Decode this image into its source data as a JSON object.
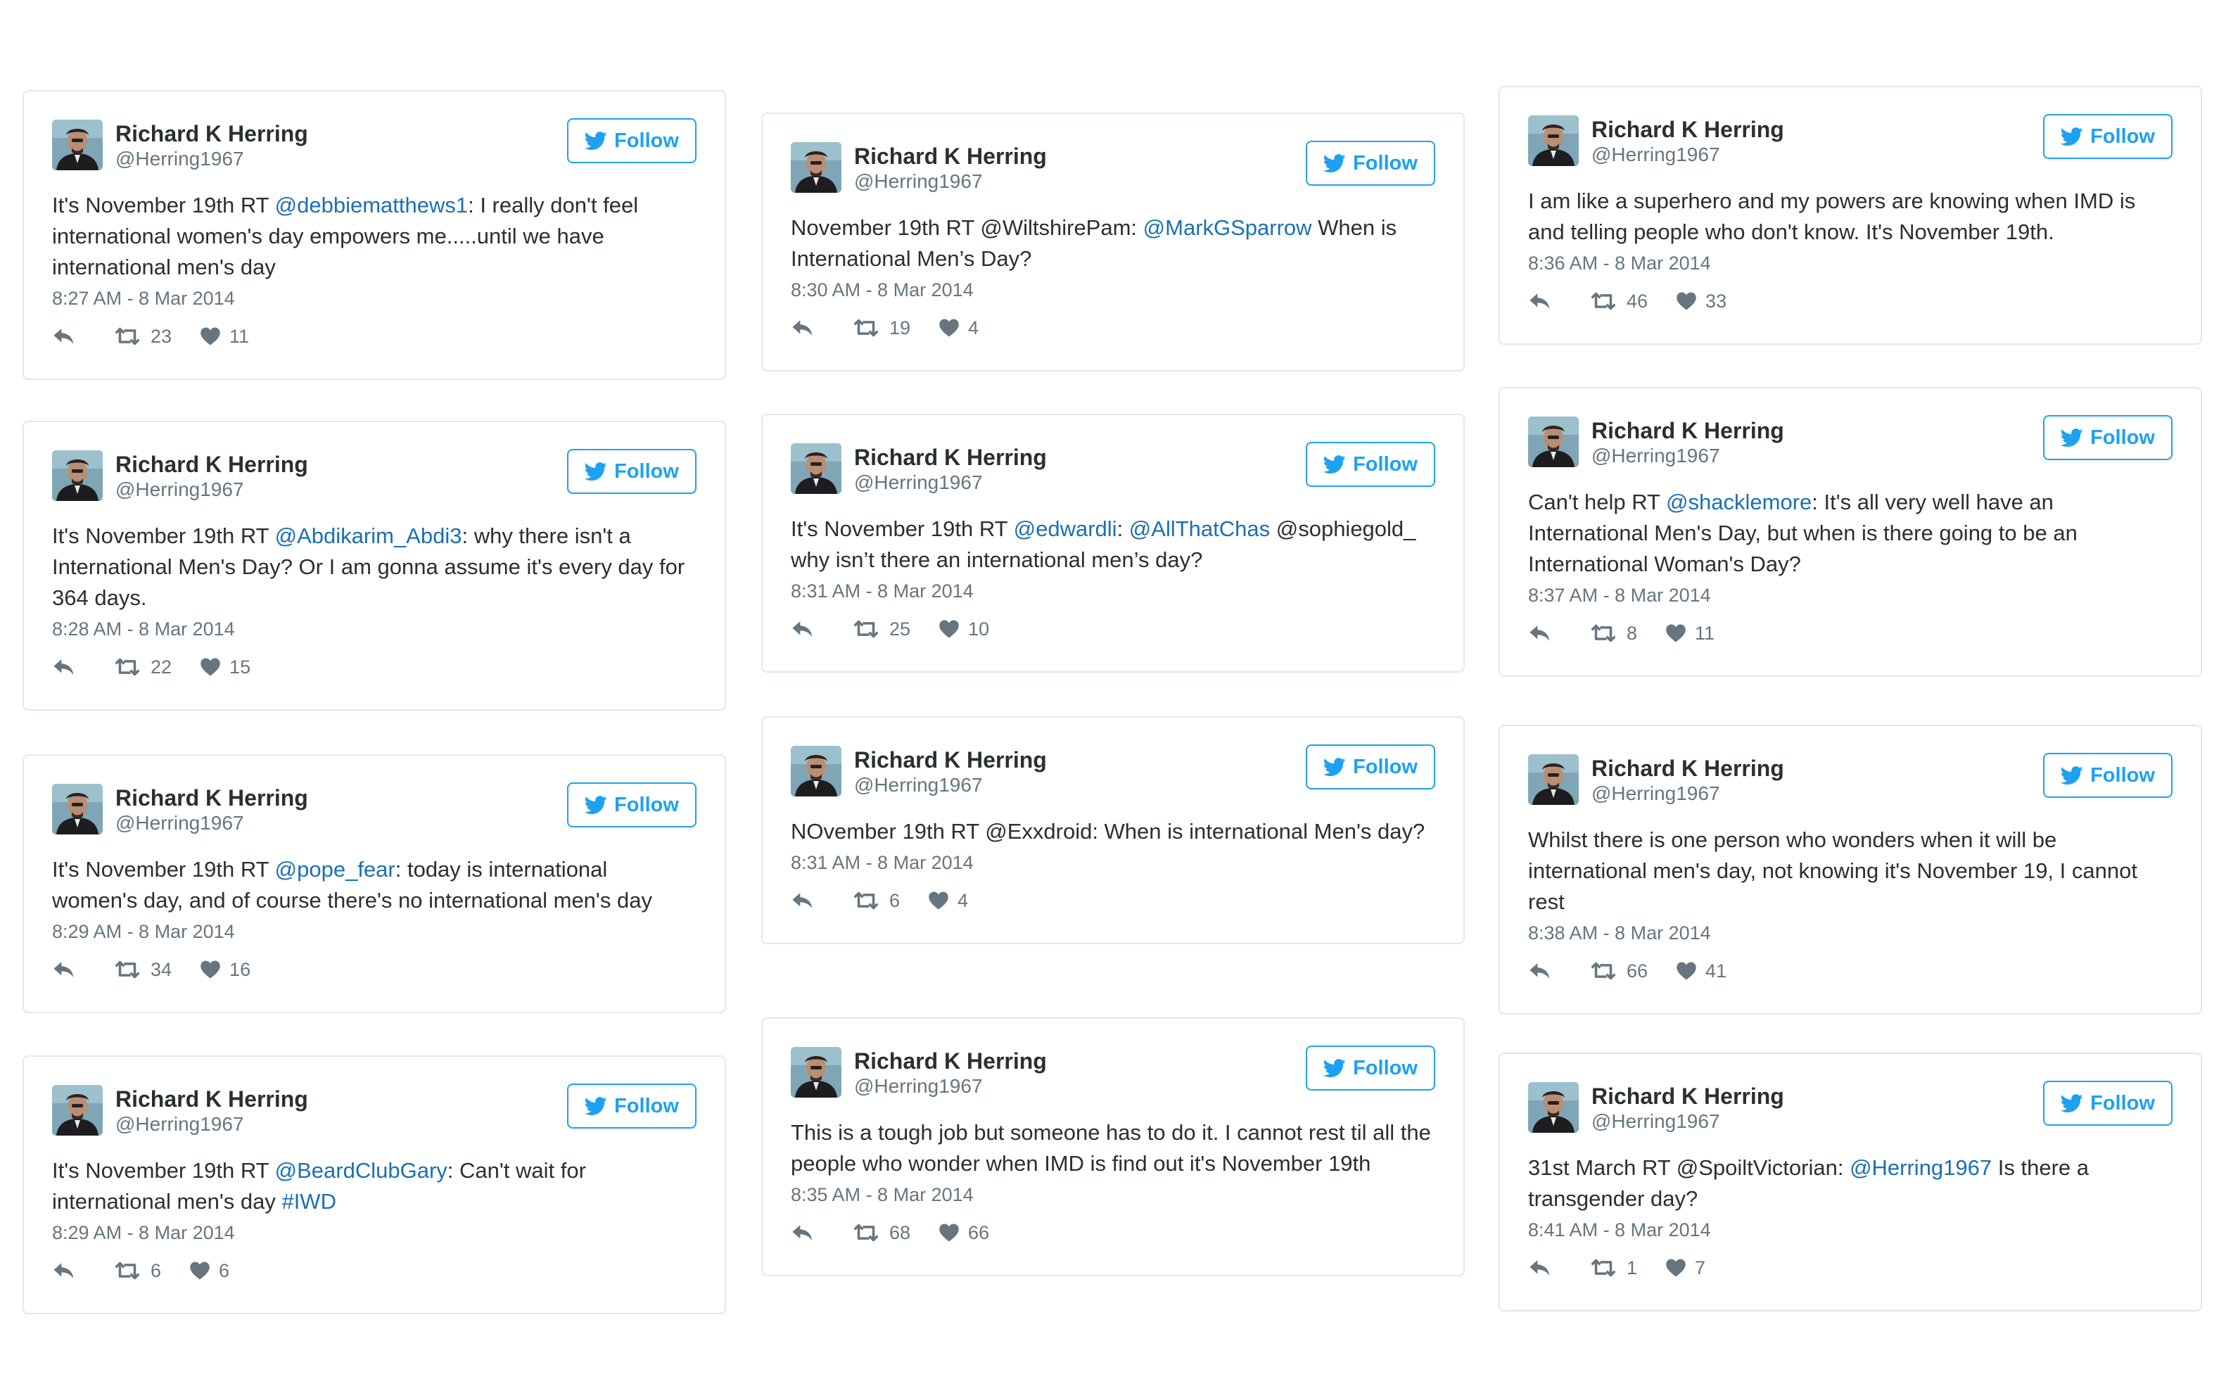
{
  "author": {
    "name": "Richard K Herring",
    "handle": "@Herring1967"
  },
  "follow_label": "Follow",
  "columns": [
    [
      {
        "segments": [
          [
            "t",
            "It's November 19th RT "
          ],
          [
            "l",
            "@debbiematthews1"
          ],
          [
            "t",
            ": I really don't feel international women's day empowers me.....until we have international men's day"
          ]
        ],
        "time": "8:27 AM - 8 Mar 2014",
        "retweets": "23",
        "likes": "11"
      },
      {
        "segments": [
          [
            "t",
            "It's November 19th RT "
          ],
          [
            "l",
            "@Abdikarim_Abdi3"
          ],
          [
            "t",
            ": why there isn't a International Men's Day? Or I am gonna assume it's every day for 364 days."
          ]
        ],
        "time": "8:28 AM - 8 Mar 2014",
        "retweets": "22",
        "likes": "15"
      },
      {
        "segments": [
          [
            "t",
            "It's November 19th RT "
          ],
          [
            "l",
            "@pope_fear"
          ],
          [
            "t",
            ": today is international women's day, and of course there's no international men's day"
          ]
        ],
        "time": "8:29 AM - 8 Mar 2014",
        "retweets": "34",
        "likes": "16"
      },
      {
        "segments": [
          [
            "t",
            "It's November 19th RT "
          ],
          [
            "l",
            "@BeardClubGary"
          ],
          [
            "t",
            ": Can't wait for international men's day "
          ],
          [
            "l",
            "#IWD"
          ]
        ],
        "time": "8:29 AM - 8 Mar 2014",
        "retweets": "6",
        "likes": "6"
      }
    ],
    [
      {
        "segments": [
          [
            "t",
            "November 19th RT @WiltshirePam: "
          ],
          [
            "l",
            "@MarkGSparrow"
          ],
          [
            "t",
            " When is International Men’s Day?"
          ]
        ],
        "time": "8:30 AM - 8 Mar 2014",
        "retweets": "19",
        "likes": "4"
      },
      {
        "segments": [
          [
            "t",
            "It's November 19th RT "
          ],
          [
            "l",
            "@edwardli"
          ],
          [
            "t",
            ": "
          ],
          [
            "l",
            "@AllThatChas"
          ],
          [
            "t",
            " @sophiegold_ why isn’t there an international men’s day?"
          ]
        ],
        "time": "8:31 AM - 8 Mar 2014",
        "retweets": "25",
        "likes": "10"
      },
      {
        "segments": [
          [
            "t",
            "NOvember 19th RT @Exxdroid: When is international Men's day?"
          ]
        ],
        "time": "8:31 AM - 8 Mar 2014",
        "retweets": "6",
        "likes": "4"
      },
      {
        "segments": [
          [
            "t",
            "This is a tough job but someone has to do it. I cannot rest til all the people who wonder when IMD is find out it's November 19th"
          ]
        ],
        "time": "8:35 AM - 8 Mar 2014",
        "retweets": "68",
        "likes": "66"
      }
    ],
    [
      {
        "segments": [
          [
            "t",
            "I am like a superhero and my powers are knowing when IMD is and telling people who don't know. It's November 19th."
          ]
        ],
        "time": "8:36 AM - 8 Mar 2014",
        "retweets": "46",
        "likes": "33"
      },
      {
        "segments": [
          [
            "t",
            "Can't help RT "
          ],
          [
            "l",
            "@shacklemore"
          ],
          [
            "t",
            ": It's all very well have an International Men's Day, but when is there going to be an International Woman's Day?"
          ]
        ],
        "time": "8:37 AM - 8 Mar 2014",
        "retweets": "8",
        "likes": "11"
      },
      {
        "segments": [
          [
            "t",
            "Whilst there is one person who wonders when it will be international men's day, not knowing it's November 19, I cannot rest"
          ]
        ],
        "time": "8:38 AM - 8 Mar 2014",
        "retweets": "66",
        "likes": "41"
      },
      {
        "segments": [
          [
            "t",
            "31st March RT @SpoiltVictorian: "
          ],
          [
            "l",
            "@Herring1967"
          ],
          [
            "t",
            " Is there a transgender day?"
          ]
        ],
        "time": "8:41 AM - 8 Mar 2014",
        "retweets": "1",
        "likes": "7"
      }
    ]
  ],
  "icons": {
    "follow": "twitter-bird-icon",
    "reply": "reply-arrow-icon",
    "retweet": "retweet-icon",
    "like": "heart-icon"
  },
  "colors": {
    "accent": "#1da1f2",
    "link": "#1b6fb5",
    "meta": "#66757f",
    "border": "#e1e8ed"
  }
}
